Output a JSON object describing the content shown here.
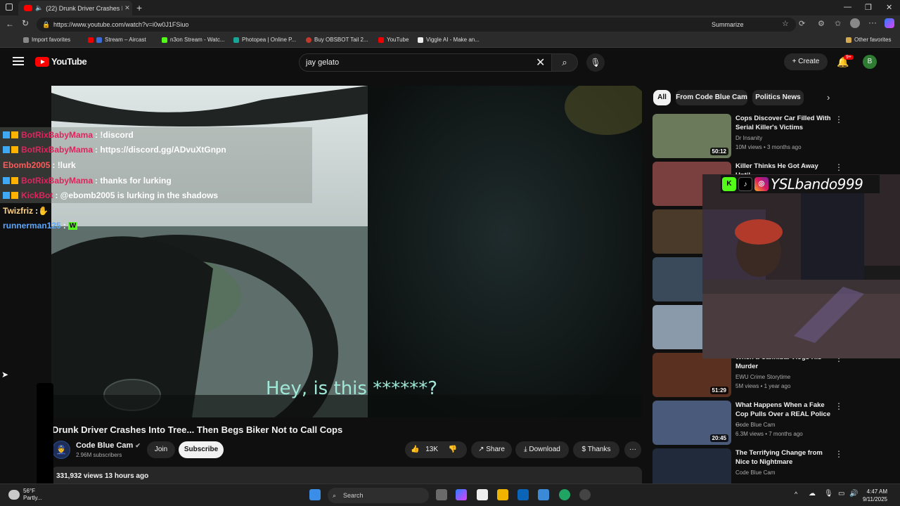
{
  "browser": {
    "tab_title": "(22) Drunk Driver Crashes Int",
    "url": "https://www.youtube.com/watch?v=i0w0J1FSiuo",
    "summarize": "Summarize",
    "favorites": [
      "Import favorites",
      "Stream – Aircast",
      "n3on Stream - Watc...",
      "Photopea | Online P...",
      "Buy OBSBOT Tail 2...",
      "YouTube",
      "Viggle AI - Make an..."
    ],
    "other_favorites": "Other favorites"
  },
  "header": {
    "logo": "YouTube",
    "search_value": "jay gelato",
    "create": "Create",
    "notif_count": "9+",
    "avatar_letter": "B"
  },
  "chat": [
    {
      "user": "BotRixBabyMama",
      "msg": ": !discord",
      "color": "#e0245e",
      "badges": true,
      "bg": true
    },
    {
      "user": "BotRixBabyMama",
      "msg": ": https://discord.gg/ADvuXtGnpn",
      "color": "#e0245e",
      "badges": true,
      "bg": true
    },
    {
      "user": "Ebomb2005",
      "msg": ": !lurk",
      "color": "#ff5a5a",
      "badges": false,
      "bg": true
    },
    {
      "user": "BotRixBabyMama",
      "msg": ": thanks for lurking",
      "color": "#e0245e",
      "badges": true,
      "bg": true
    },
    {
      "user": "KickBot",
      "msg": ": @ebomb2005 is lurking in the shadows",
      "color": "#e0245e",
      "badges": true,
      "bg": true
    },
    {
      "user": "Twizfriz",
      "msg": ": ",
      "color": "#ffd28a",
      "badges": false,
      "bg": false
    },
    {
      "user": "runnerman125",
      "msg": ": ",
      "color": "#5aa7ff",
      "badges": false,
      "bg": false
    }
  ],
  "video": {
    "subtitle": "Hey, is this ******?",
    "title": "Drunk Driver Crashes Into Tree... Then Begs Biker Not to Call Cops",
    "channel": "Code Blue Cam",
    "subscribers": "2.96M subscribers",
    "join": "Join",
    "subscribe": "Subscribe",
    "likes": "13K",
    "share": "Share",
    "download": "Download",
    "thanks": "Thanks",
    "views": "331,932 views  13 hours ago"
  },
  "chips": [
    "All",
    "From Code Blue Cam",
    "Politics News"
  ],
  "recommendations": [
    {
      "title": "Cops Discover Car Filled With Serial Killer's Victims",
      "channel": "Dr Insanity",
      "meta": "10M views • 3 months ago",
      "duration": "50:12"
    },
    {
      "title": "Killer Thinks He Got Away Until",
      "channel": "",
      "meta": "",
      "duration": ""
    },
    {
      "title": "",
      "channel": "",
      "meta": "",
      "duration": ""
    },
    {
      "title": "",
      "channel": "",
      "meta": "",
      "duration": ""
    },
    {
      "title": "",
      "channel": "",
      "meta": "",
      "duration": ""
    },
    {
      "title": "When a Cannibal Vlogs His Murder",
      "channel": "EWU Crime Storytime",
      "meta": "5M views • 1 year ago",
      "duration": "51:29"
    },
    {
      "title": "What Happens When a Fake Cop Pulls Over a REAL Police ...",
      "channel": "Code Blue Cam",
      "meta": "6.3M views • 7 months ago",
      "duration": "20:45"
    },
    {
      "title": "The Terrifying Change from Nice to Nightmare",
      "channel": "Code Blue Cam",
      "meta": "",
      "duration": ""
    }
  ],
  "stream_overlay": {
    "handle": "YSLbando999"
  },
  "taskbar": {
    "search": "Search",
    "weather_temp": "56°F",
    "weather_desc": "Partly...",
    "time": "4:47 AM",
    "date": "9/11/2025"
  }
}
